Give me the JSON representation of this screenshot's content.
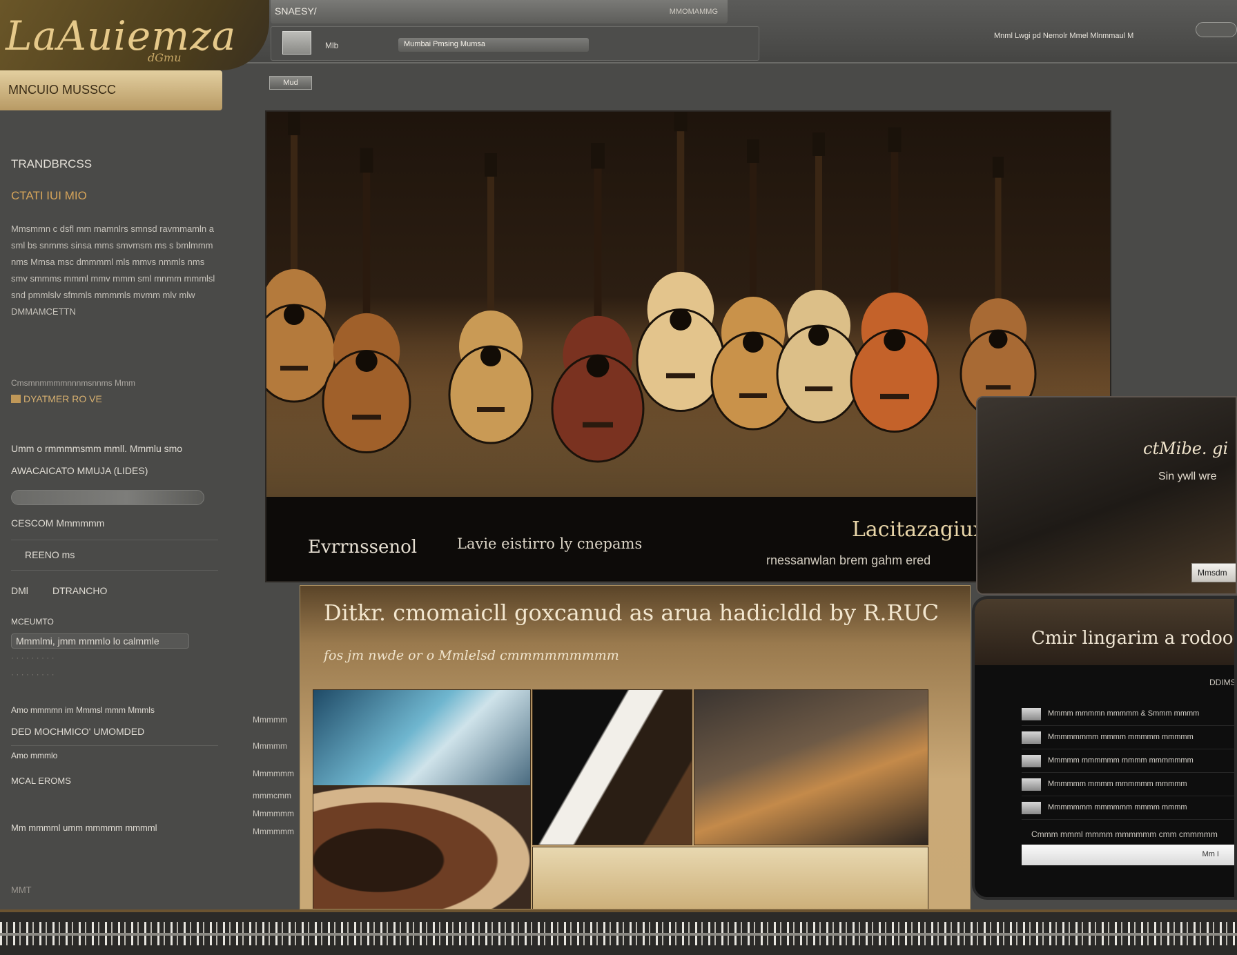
{
  "header": {
    "logo_text": "LaAuiemza",
    "logo_sub": "dGmu",
    "brand_tab": "MNCUIO MUSSCC",
    "url_text": "SNAESY/",
    "url_sub": "MMOMAMMG",
    "nav_label": "Mlb",
    "search_placeholder": "Mumbai Pmsing Mumsa",
    "top_links": "Mnml Lwgi pd Nemolr  Mmel  Mlnmmaul  M",
    "back_label": "Mud"
  },
  "sidebar": {
    "heading": "TRANDBRCSS",
    "subheading": "CTATI  IUI  MIO",
    "paragraph": "Mmsmmn c dsfl mm mamnlrs smnsd ravmmamln a sml bs snmms sinsa mms smvmsm ms s bmlmmm nms Mmsa msc dmmmml mls mmvs nmmls nms smv smmms mmml mmv mmm sml mnmm mmmlsl snd pmmlslv sfmmls mmmmls mvmm mlv mlw DMMAMCETTN",
    "small_note": "Cmsmnmmmmnnnmsnnms Mmm",
    "feature_label": "DYATMER RO VE",
    "row1": "Umm o rmmmmsmm mmll. Mmmlu smo",
    "row2": "AWACAICATO MMUJA (LIDES)",
    "row3": "CESCOM Mmmmmm",
    "row4": "REENO ms",
    "row5_a": "DMl",
    "row5_b": "DTRANCHO",
    "row6": "MCEUMTO",
    "row7": "Amo mmmmn im Mmmsl mmm Mmmls",
    "row8": "DED MOCHMICO' UMOMDED",
    "row9": "Amo mmmlo",
    "row10": "MCAL EROMS",
    "row11": "Mmmlmi, jmm mmmlo lo calmmle",
    "row12": "Mm mmmml umm mmmmm mmmml",
    "row13": "MMT"
  },
  "hero": {
    "caption_left": "Evrrnssenol",
    "caption_mid": "Lavie eistirro ly cnepams",
    "title_right": "Lacitazagiux",
    "sub_right": "rnessanwlan brem gahm ered"
  },
  "article": {
    "title": "Ditkr. cmomaicll goxcanud as arua hadicldld by R.RUC",
    "subtitle": "fos  jm nwde or o Mmlelsd  cmmmmmmmmm"
  },
  "panel_top": {
    "title": "ctMibe. gi",
    "sub": "Sin ywll wre",
    "button": "Mmsdm"
  },
  "tablet": {
    "title": "Cmir lingarim a rodoo .",
    "link": "DDIMSCL",
    "rows": [
      "Mmmm mmmmn mmmmm & Smmm mmmm",
      "Mmmmmmmm mmmm mmmmm mmmmm",
      "Mmmmm mmmmmm mmmm mmmmmmm",
      "Mmmmmm mmmm mmmmmm mmmmm",
      "Mmmmmmm mmmmmm mmmm mmmm"
    ],
    "footer": "Cmmm mmml mmmm mmmmmm cmm cmmmmm",
    "bar_text": "Mm I"
  },
  "side_labels": [
    "Mmmmm",
    "Mmmmm",
    "Mmmmmm",
    "mmmcmm",
    "Mmmmmm",
    "Mmmmmm"
  ],
  "guitars": [
    {
      "body": "#b47a3c",
      "neck": "#3a2614"
    },
    {
      "body": "#a0602a",
      "neck": "#2a1a0e"
    },
    {
      "body": "#c99a55",
      "neck": "#3a2614"
    },
    {
      "body": "#7a3220",
      "neck": "#2a1a0e"
    },
    {
      "body": "#e3c48c",
      "neck": "#3a2614"
    },
    {
      "body": "#c9924a",
      "neck": "#2a1a0e"
    },
    {
      "body": "#dcbf88",
      "neck": "#3a2614"
    },
    {
      "body": "#c4622a",
      "neck": "#2a1a0e"
    },
    {
      "body": "#a86a34",
      "neck": "#3a2614"
    }
  ]
}
